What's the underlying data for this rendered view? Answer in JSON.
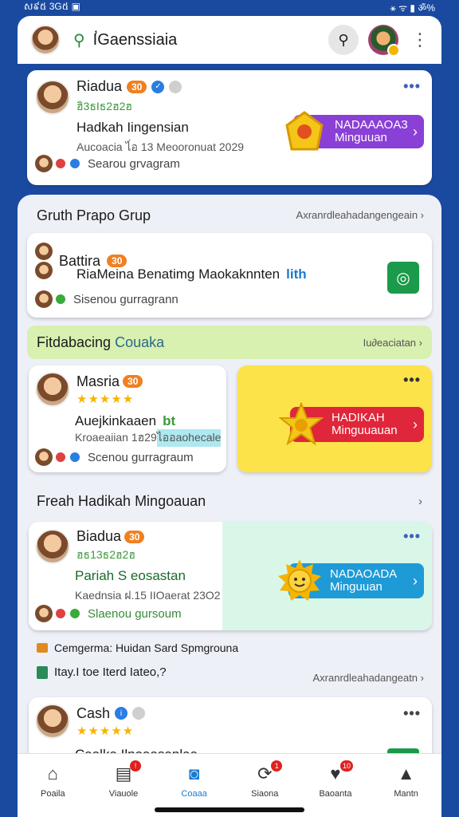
{
  "status": {
    "left": "ស៩៥ 3G៥ ▣",
    "right": "⚹ ᯤ ▮ ॐ%"
  },
  "header": {
    "search_text": "I̛Gaenssiaia"
  },
  "featured": {
    "name": "Riadua",
    "badge": "30",
    "green_line": "ฮิ3ธIธ2ฮ2ฮ",
    "title": "Hadkah Iingensian",
    "subtitle": "Aucoacia ไ่อ 13 Meooronuat 2029",
    "footer": "Searou grvagram",
    "cta": "NADAAAOA3 Minguuan",
    "cta_color": "#8a3fd6"
  },
  "section1": {
    "title": "Gruth Prapo Grup",
    "see_all": "Axranrdleahadangengeain",
    "card": {
      "name": "Battira",
      "badge": "30",
      "line": "RiaMeina Benatimg Maokaknnten",
      "line_tail": "lith",
      "footer": "Sisenou gurragrann"
    }
  },
  "section2": {
    "title_bold": "Fitdabacing",
    "title_rest": "Couaka",
    "see_all": "Iu∂eaciatan",
    "card": {
      "name": "Masria",
      "badge": "30",
      "stars": "★★★★★",
      "title": "Auejkinkaaen",
      "title_tail": "bt",
      "sub": "Kroaeaiian 1ฮ29",
      "sub_hl": "ไออaohecale",
      "footer": "Scenou gurragraum"
    },
    "cta": "HADIKAH Minguuauan",
    "cta_color": "#e0263a"
  },
  "section3": {
    "title": "Freah Hadikah Mingoauan",
    "card": {
      "name": "Biadua",
      "badge": "30",
      "green_line": "ฮธ13ธ2ฮ2ฮ",
      "title": "Pariah S eosastan",
      "sub": "Kaednsia ฝ.15 IIOaerat 23O2",
      "footer": "Slaenou gursoum"
    },
    "cta": "NADAOADA Minguuan",
    "cta_color": "#1e9ad6"
  },
  "info_lines": {
    "line1": "Cemgerma: Huidan Sard Spmgrouna",
    "line2": "Itay.I toe Iterd Iateo,?",
    "see_all": "Axranrdleahadangeatn"
  },
  "section4": {
    "name": "Cash",
    "stars": "★★★★★",
    "partial": "Caalka Ilnaaasanlaa"
  },
  "tabs": [
    {
      "label": "Poaila",
      "icon": "⌂",
      "badge": ""
    },
    {
      "label": "Viauole",
      "icon": "▤",
      "badge": "!"
    },
    {
      "label": "Coaaa",
      "icon": "◙",
      "badge": ""
    },
    {
      "label": "Siaona",
      "icon": "⟳",
      "badge": "1"
    },
    {
      "label": "Baoanta",
      "icon": "♥",
      "badge": "10"
    },
    {
      "label": "Mantn",
      "icon": "▲",
      "badge": ""
    }
  ]
}
